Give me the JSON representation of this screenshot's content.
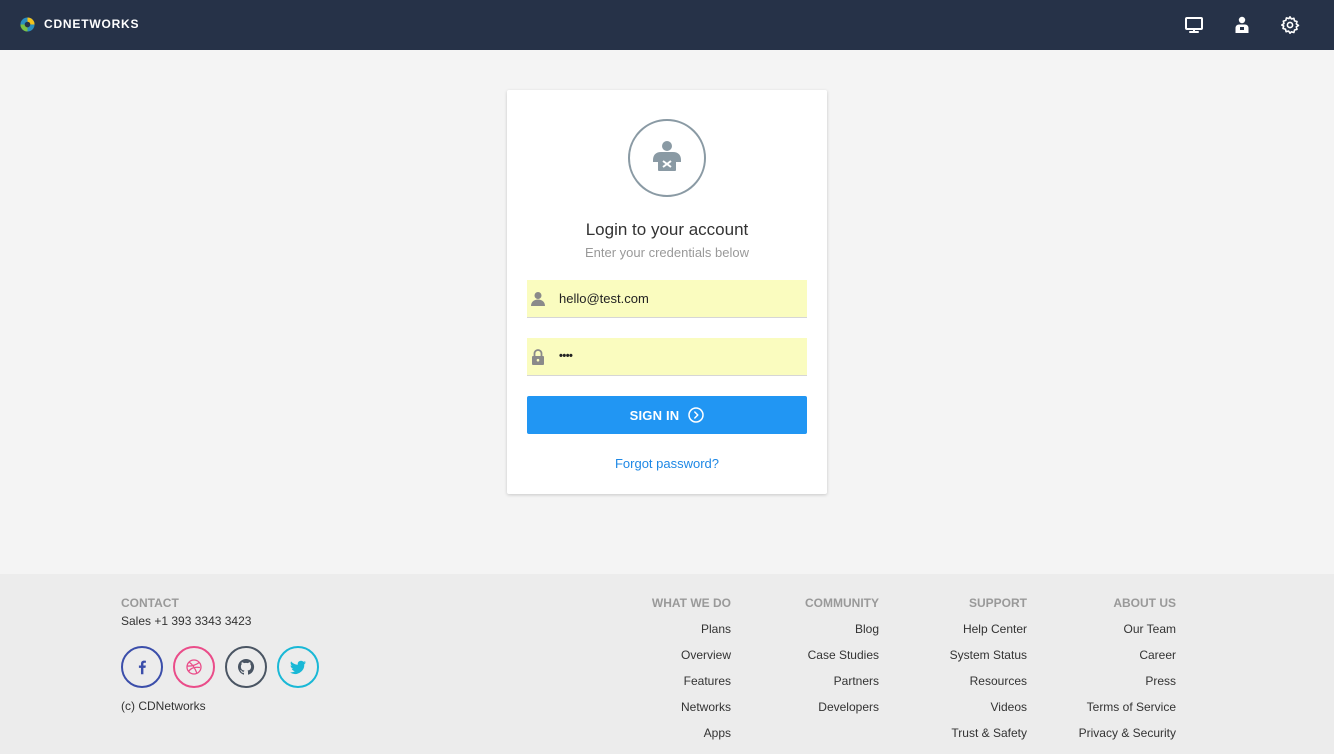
{
  "header": {
    "brand": "CDNETWORKS",
    "icons": [
      "monitor-icon",
      "user-badge-icon",
      "settings-gear-icon"
    ],
    "bg_color": "#263248"
  },
  "login": {
    "title": "Login to your account",
    "subtitle": "Enter your credentials below",
    "email_value": "hello@test.com",
    "password_value": "••••",
    "sign_in_label": "SIGN IN",
    "forgot_label": "Forgot password?",
    "accent_color": "#2196f3",
    "autofill_color": "#fafcbf"
  },
  "footer": {
    "contact": {
      "heading": "CONTACT",
      "sales": "Sales +1 393 3343 3423",
      "copyright": "(c) CDNetworks"
    },
    "social": [
      {
        "icon": "facebook-icon",
        "color": "#3b4eaa"
      },
      {
        "icon": "dribbble-icon",
        "color": "#ea4c89"
      },
      {
        "icon": "github-icon",
        "color": "#4a5563"
      },
      {
        "icon": "twitter-icon",
        "color": "#19b8d6"
      }
    ],
    "columns": [
      {
        "heading": "WHAT WE DO",
        "items": [
          "Plans",
          "Overview",
          "Features",
          "Networks",
          "Apps"
        ]
      },
      {
        "heading": "COMMUNITY",
        "items": [
          "Blog",
          "Case Studies",
          "Partners",
          "Developers"
        ]
      },
      {
        "heading": "SUPPORT",
        "items": [
          "Help Center",
          "System Status",
          "Resources",
          "Videos",
          "Trust & Safety"
        ]
      },
      {
        "heading": "ABOUT US",
        "items": [
          "Our Team",
          "Career",
          "Press",
          "Terms of Service",
          "Privacy & Security"
        ]
      }
    ]
  }
}
